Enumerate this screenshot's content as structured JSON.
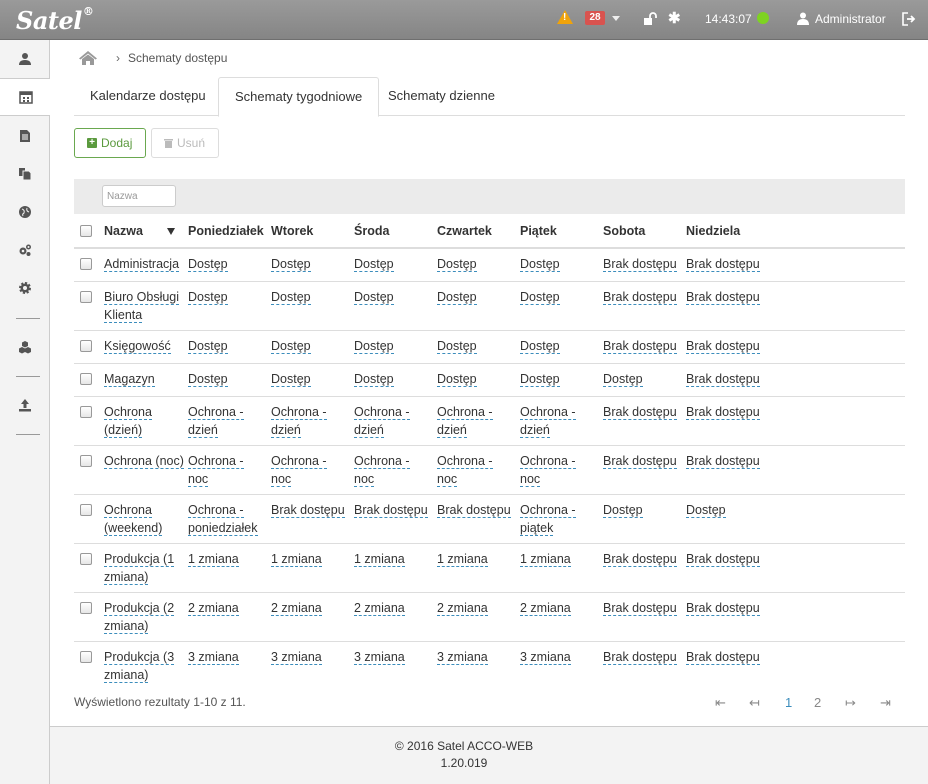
{
  "app": {
    "logo": "Satel",
    "logo_mark": "®"
  },
  "topbar": {
    "alert_count": "28",
    "time": "14:43:07",
    "user": "Administrator",
    "status_color": "#7ed321",
    "icons": [
      "warning-icon",
      "caret-down-icon",
      "unlock-icon",
      "asterisk-icon",
      "user-icon",
      "logout-icon"
    ]
  },
  "sidebar": {
    "items": [
      "user-icon",
      "calendar-icon",
      "document-icon",
      "copy-icon",
      "globe-icon",
      "cogs-icon",
      "gear-icon",
      "cubes-icon",
      "upload-icon"
    ],
    "active": "calendar-icon"
  },
  "breadcrumb": {
    "current": "Schematy dostępu"
  },
  "tabs": [
    {
      "label": "Kalendarze dostępu",
      "active": false
    },
    {
      "label": "Schematy tygodniowe",
      "active": true
    },
    {
      "label": "Schematy dzienne",
      "active": false
    }
  ],
  "toolbar": {
    "add_label": "Dodaj",
    "delete_label": "Usuń"
  },
  "filter": {
    "placeholder": "Nazwa"
  },
  "table": {
    "headers": [
      "Nazwa",
      "Poniedziałek",
      "Wtorek",
      "Środa",
      "Czwartek",
      "Piątek",
      "Sobota",
      "Niedziela"
    ],
    "rows": [
      [
        "Administracja",
        "Dostęp",
        "Dostęp",
        "Dostęp",
        "Dostęp",
        "Dostęp",
        "Brak dostępu",
        "Brak dostępu"
      ],
      [
        "Biuro Obsługi Klienta",
        "Dostęp",
        "Dostęp",
        "Dostęp",
        "Dostęp",
        "Dostęp",
        "Brak dostępu",
        "Brak dostępu"
      ],
      [
        "Księgowość",
        "Dostęp",
        "Dostęp",
        "Dostęp",
        "Dostęp",
        "Dostęp",
        "Brak dostępu",
        "Brak dostępu"
      ],
      [
        "Magazyn",
        "Dostęp",
        "Dostęp",
        "Dostęp",
        "Dostęp",
        "Dostęp",
        "Dostęp",
        "Brak dostępu"
      ],
      [
        "Ochrona (dzień)",
        "Ochrona - dzień",
        "Ochrona - dzień",
        "Ochrona - dzień",
        "Ochrona - dzień",
        "Ochrona - dzień",
        "Brak dostępu",
        "Brak dostępu"
      ],
      [
        "Ochrona (noc)",
        "Ochrona - noc",
        "Ochrona - noc",
        "Ochrona - noc",
        "Ochrona - noc",
        "Ochrona - noc",
        "Brak dostępu",
        "Brak dostępu"
      ],
      [
        "Ochrona (weekend)",
        "Ochrona - poniedziałek",
        "Brak dostępu",
        "Brak dostępu",
        "Brak dostępu",
        "Ochrona - piątek",
        "Dostęp",
        "Dostęp"
      ],
      [
        "Produkcja (1 zmiana)",
        "1 zmiana",
        "1 zmiana",
        "1 zmiana",
        "1 zmiana",
        "1 zmiana",
        "Brak dostępu",
        "Brak dostępu"
      ],
      [
        "Produkcja (2 zmiana)",
        "2 zmiana",
        "2 zmiana",
        "2 zmiana",
        "2 zmiana",
        "2 zmiana",
        "Brak dostępu",
        "Brak dostępu"
      ],
      [
        "Produkcja (3 zmiana)",
        "3 zmiana",
        "3 zmiana",
        "3 zmiana",
        "3 zmiana",
        "3 zmiana",
        "Brak dostępu",
        "Brak dostępu"
      ]
    ]
  },
  "pagination": {
    "summary": "Wyświetlono rezultaty 1-10 z 11.",
    "first": "⇤",
    "prev": "↤",
    "pages": [
      "1",
      "2"
    ],
    "current": "1",
    "next": "↦",
    "last": "⇥"
  },
  "footer": {
    "copyright": "© 2016 Satel",
    "product": "ACCO-WEB",
    "version": "1.20.019"
  }
}
